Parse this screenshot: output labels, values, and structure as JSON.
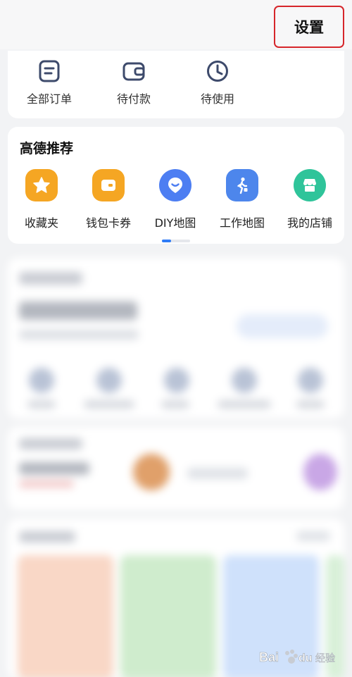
{
  "header": {
    "settings_label": "设置"
  },
  "orders": {
    "items": [
      {
        "label": "全部订单",
        "icon": "order-list-icon"
      },
      {
        "label": "待付款",
        "icon": "wallet-icon"
      },
      {
        "label": "待使用",
        "icon": "clock-icon"
      }
    ]
  },
  "recommend": {
    "title": "高德推荐",
    "items": [
      {
        "label": "收藏夹",
        "icon": "star-icon",
        "color": "#f5a623"
      },
      {
        "label": "钱包卡券",
        "icon": "wallet-card-icon",
        "color": "#f5a623"
      },
      {
        "label": "DIY地图",
        "icon": "diy-map-icon",
        "color": "#4d7ef2"
      },
      {
        "label": "工作地图",
        "icon": "walking-person-icon",
        "color": "#4d86ec"
      },
      {
        "label": "我的店铺",
        "icon": "store-icon",
        "color": "#2fc49a"
      }
    ],
    "pager": {
      "active_page": 1,
      "total_pages": 3
    }
  },
  "colors": {
    "settings_highlight": "#d6262b",
    "accent": "#2f7cf6"
  },
  "watermark": {
    "text": "Baidu 经验"
  }
}
